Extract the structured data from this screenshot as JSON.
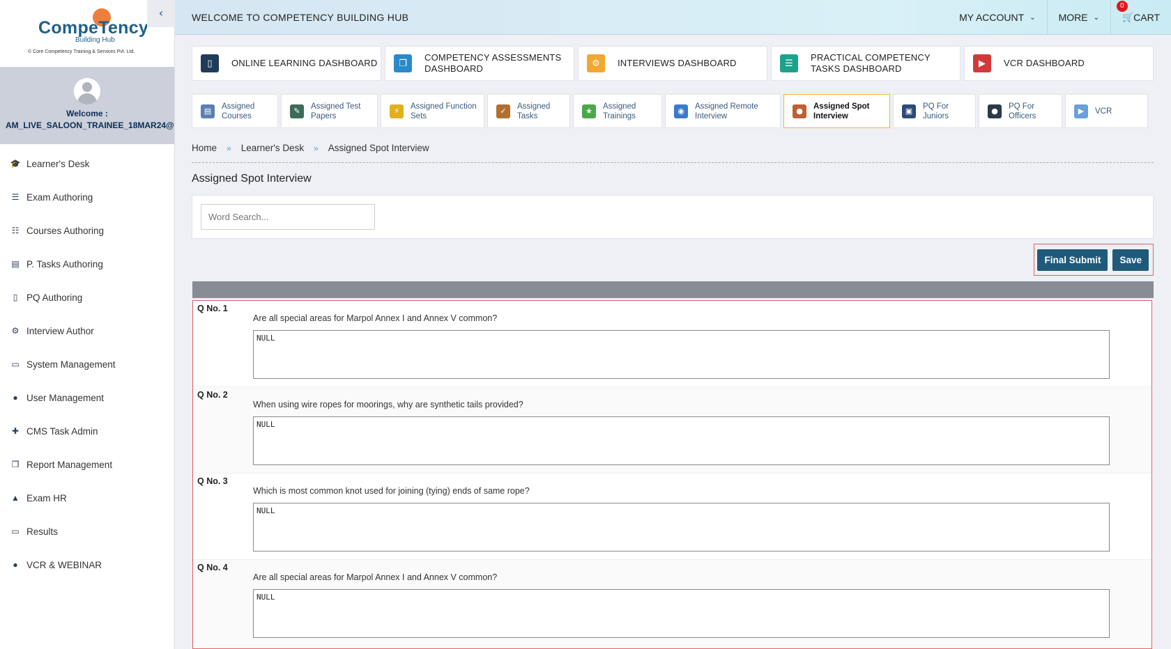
{
  "brand": {
    "name": "CompeTency",
    "subtitle": "Building Hub",
    "company": "© Core Competency Training & Services Pvt. Ltd."
  },
  "sidebar": {
    "collapse_icon": "chevron-left-icon",
    "welcome": "Welcome :",
    "username": "AM_LIVE_SALOON_TRAINEE_18MAR24@",
    "items": [
      {
        "label": "Learner's Desk",
        "icon": "graduation-cap-icon"
      },
      {
        "label": "Exam Authoring",
        "icon": "list-icon"
      },
      {
        "label": "Courses Authoring",
        "icon": "sitemap-icon"
      },
      {
        "label": "P. Tasks Authoring",
        "icon": "list-alt-icon"
      },
      {
        "label": "PQ Authoring",
        "icon": "book-icon"
      },
      {
        "label": "Interview Author",
        "icon": "gears-icon"
      },
      {
        "label": "System Management",
        "icon": "desktop-icon"
      },
      {
        "label": "User Management",
        "icon": "user-icon"
      },
      {
        "label": "CMS Task Admin",
        "icon": "user-plus-icon"
      },
      {
        "label": "Report Management",
        "icon": "copy-icon"
      },
      {
        "label": "Exam HR",
        "icon": "bank-icon"
      },
      {
        "label": "Results",
        "icon": "desktop-icon"
      },
      {
        "label": "VCR & WEBINAR",
        "icon": "users-icon"
      }
    ]
  },
  "topbar": {
    "title": "WELCOME TO COMPETENCY BUILDING HUB",
    "my_account": "MY ACCOUNT",
    "more": "MORE",
    "cart": "CART",
    "cart_count": "0"
  },
  "dashboards": [
    {
      "label": "ONLINE LEARNING DASHBOARD",
      "icon": "book-icon",
      "color": "#1f3b5a"
    },
    {
      "label": "COMPETENCY ASSESSMENTS DASHBOARD",
      "icon": "copy-icon",
      "color": "#2a89c8"
    },
    {
      "label": "INTERVIEWS DASHBOARD",
      "icon": "gears-icon",
      "color": "#f0a830"
    },
    {
      "label": "PRACTICAL COMPETENCY TASKS DASHBOARD",
      "icon": "tasks-icon",
      "color": "#1aa38a"
    },
    {
      "label": "VCR DASHBOARD",
      "icon": "video-file-icon",
      "color": "#d23a3a"
    }
  ],
  "subtabs": [
    {
      "label": "Assigned Courses",
      "icon": "document-icon",
      "color": "#5a7fb0"
    },
    {
      "label": "Assigned Test Papers",
      "icon": "test-paper-icon",
      "color": "#3d6b5a"
    },
    {
      "label": "Assigned Function Sets",
      "icon": "function-icon",
      "color": "#e0b020"
    },
    {
      "label": "Assigned Tasks",
      "icon": "clipboard-icon",
      "color": "#b07030"
    },
    {
      "label": "Assigned Trainings",
      "icon": "training-icon",
      "color": "#4aa84a"
    },
    {
      "label": "Assigned Remote Interview",
      "icon": "remote-interview-icon",
      "color": "#3a7ac8"
    },
    {
      "label": "Assigned Spot Interview",
      "icon": "spot-interview-icon",
      "color": "#c06030",
      "active": true
    },
    {
      "label": "PQ For Juniors",
      "icon": "presentation-icon",
      "color": "#2a4a7a"
    },
    {
      "label": "PQ For Officers",
      "icon": "officer-icon",
      "color": "#2a3a4a"
    },
    {
      "label": "VCR",
      "icon": "vcr-icon",
      "color": "#6aa0d8"
    }
  ],
  "breadcrumb": [
    "Home",
    "Learner's Desk",
    "Assigned Spot Interview"
  ],
  "page_title": "Assigned Spot Interview",
  "search": {
    "placeholder": "Word Search..."
  },
  "actions": {
    "final_submit": "Final Submit",
    "save": "Save"
  },
  "questions": [
    {
      "no": "Q No. 1",
      "text": "Are all special areas for Marpol Annex I and Annex V common?",
      "answer": "NULL"
    },
    {
      "no": "Q No. 2",
      "text": "When using wire ropes for moorings, why are synthetic tails provided?",
      "answer": "NULL"
    },
    {
      "no": "Q No. 3",
      "text": "Which is most common knot used for joining (tying) ends of same rope?",
      "answer": "NULL"
    },
    {
      "no": "Q No. 4",
      "text": "Are all special areas for Marpol Annex I and Annex V common?",
      "answer": "NULL"
    }
  ]
}
